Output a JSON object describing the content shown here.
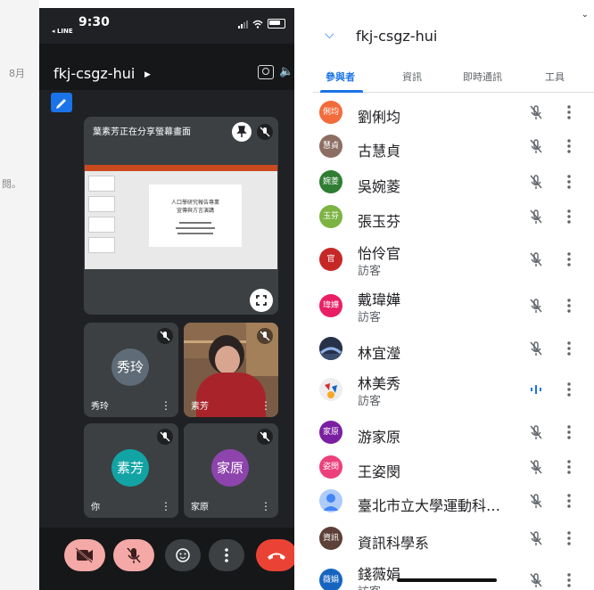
{
  "background": {
    "fragments": [
      "8月",
      "閱。"
    ]
  },
  "status_bar": {
    "time": "9:30",
    "back_app": "◂ LINE"
  },
  "call": {
    "title": "fkj-csgz-hui",
    "share_tile_label": "葉素芳正在分享螢幕畫面",
    "slide_title_line1": "人口學研究報告專業",
    "slide_title_line2": "宣傳與方言演講",
    "tiles": [
      {
        "name": "秀玲",
        "initials": "秀玲",
        "color": "#5f6b76"
      },
      {
        "name": "素芳",
        "initials": "",
        "color": ""
      },
      {
        "name": "你",
        "initials": "素芳",
        "color": "#12a4a4"
      },
      {
        "name": "家原",
        "initials": "家原",
        "color": "#8e44ad"
      }
    ]
  },
  "panel": {
    "title": "fkj-csgz-hui",
    "tabs": [
      "參與者",
      "資訊",
      "即時通訊",
      "工具"
    ],
    "participants": [
      {
        "name": "劉俐均",
        "sub": "",
        "initials": "俐均",
        "color": "#f26b3a",
        "speaking": false
      },
      {
        "name": "古慧貞",
        "sub": "",
        "initials": "慧貞",
        "color": "#8d6e63",
        "speaking": false
      },
      {
        "name": "吳婉菱",
        "sub": "",
        "initials": "婉菱",
        "color": "#2e7d32",
        "speaking": false
      },
      {
        "name": "張玉芬",
        "sub": "",
        "initials": "玉芬",
        "color": "#7cb342",
        "speaking": false
      },
      {
        "name": "怡伶官",
        "sub": "訪客",
        "initials": "官",
        "color": "#c62828",
        "speaking": false
      },
      {
        "name": "戴瑋嬅",
        "sub": "訪客",
        "initials": "瑋嬅",
        "color": "#e91e63",
        "speaking": false
      },
      {
        "name": "林宜瀅",
        "sub": "",
        "initials": "",
        "color": "#26324a",
        "speaking": false
      },
      {
        "name": "林美秀",
        "sub": "訪客",
        "initials": "",
        "color": "#f5f5f5",
        "speaking": true
      },
      {
        "name": "游家原",
        "sub": "",
        "initials": "家原",
        "color": "#7b1fa2",
        "speaking": false
      },
      {
        "name": "王姿閔",
        "sub": "",
        "initials": "姿閔",
        "color": "#ec407a",
        "speaking": false
      },
      {
        "name": "臺北市立大學運動科…",
        "sub": "",
        "initials": "",
        "color": "#aecbfa",
        "speaking": false
      },
      {
        "name": "資訊科學系",
        "sub": "",
        "initials": "資訊",
        "color": "#5d4037",
        "speaking": false
      },
      {
        "name": "錢薇娟",
        "sub": "訪客",
        "initials": "薇娟",
        "color": "#1565c0",
        "speaking": false
      }
    ]
  },
  "colors": {
    "accent": "#1a73e8",
    "end_call": "#ea4335",
    "call_bg": "#202124"
  }
}
